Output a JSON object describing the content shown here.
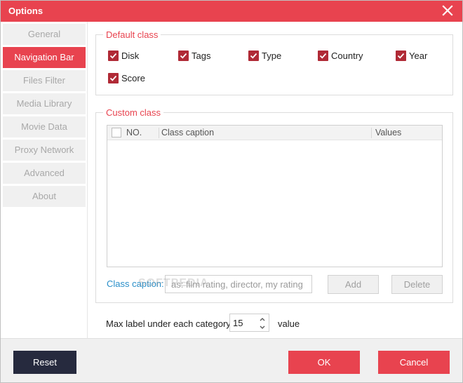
{
  "window": {
    "title": "Options"
  },
  "sidebar": {
    "items": [
      {
        "label": "General",
        "active": false
      },
      {
        "label": "Navigation Bar",
        "active": true
      },
      {
        "label": "Files Filter",
        "active": false
      },
      {
        "label": "Media Library",
        "active": false
      },
      {
        "label": "Movie Data",
        "active": false
      },
      {
        "label": "Proxy Network",
        "active": false
      },
      {
        "label": "Advanced",
        "active": false
      },
      {
        "label": "About",
        "active": false
      }
    ]
  },
  "default_class": {
    "legend": "Default class",
    "options": [
      {
        "label": "Disk",
        "checked": true
      },
      {
        "label": "Tags",
        "checked": true
      },
      {
        "label": "Type",
        "checked": true
      },
      {
        "label": "Country",
        "checked": true
      },
      {
        "label": "Year",
        "checked": true
      },
      {
        "label": "Score",
        "checked": true
      }
    ]
  },
  "custom_class": {
    "legend": "Custom class",
    "table": {
      "columns": [
        "NO.",
        "Class caption",
        "Values"
      ],
      "rows": []
    },
    "caption_label": "Class caption:",
    "caption_placeholder": "as: film rating, director, my rating",
    "add_label": "Add",
    "delete_label": "Delete"
  },
  "max_label": {
    "prefix": "Max label under each category",
    "value": "15",
    "suffix": "value"
  },
  "watermark": "SOFTPEDIA",
  "footer": {
    "reset_label": "Reset",
    "ok_label": "OK",
    "cancel_label": "Cancel"
  },
  "colors": {
    "accent": "#e8434f",
    "checkbox": "#b02a36",
    "link_blue": "#2a8fc9",
    "dark_button": "#262a3e"
  }
}
